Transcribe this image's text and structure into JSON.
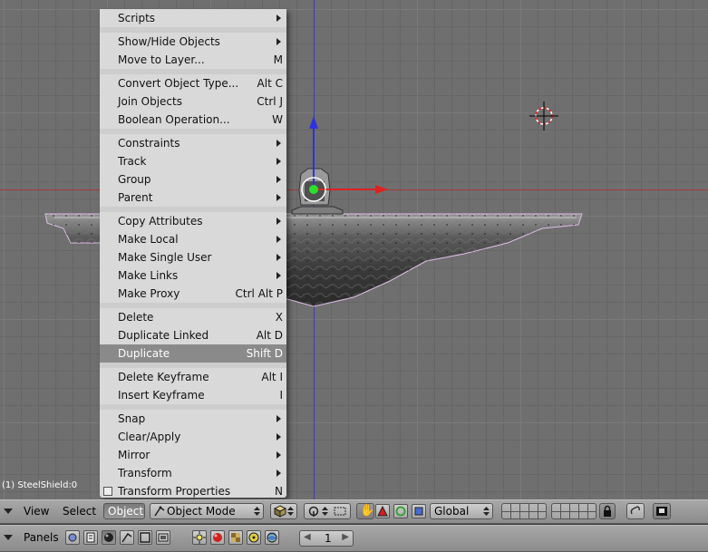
{
  "viewport": {
    "object_label": "(1) SteelShield:0"
  },
  "menu": {
    "items": [
      {
        "label": "Scripts",
        "shortcut": "",
        "submenu": true
      },
      {
        "label": "Show/Hide Objects",
        "shortcut": "",
        "submenu": true
      },
      {
        "label": "Move to Layer...",
        "shortcut": "M",
        "submenu": false
      },
      {
        "label": "Convert Object Type...",
        "shortcut": "Alt C",
        "submenu": false
      },
      {
        "label": "Join Objects",
        "shortcut": "Ctrl J",
        "submenu": false
      },
      {
        "label": "Boolean Operation...",
        "shortcut": "W",
        "submenu": false
      },
      {
        "label": "Constraints",
        "shortcut": "",
        "submenu": true
      },
      {
        "label": "Track",
        "shortcut": "",
        "submenu": true
      },
      {
        "label": "Group",
        "shortcut": "",
        "submenu": true
      },
      {
        "label": "Parent",
        "shortcut": "",
        "submenu": true
      },
      {
        "label": "Copy Attributes",
        "shortcut": "",
        "submenu": true
      },
      {
        "label": "Make Local",
        "shortcut": "",
        "submenu": true
      },
      {
        "label": "Make Single User",
        "shortcut": "",
        "submenu": true
      },
      {
        "label": "Make Links",
        "shortcut": "",
        "submenu": true
      },
      {
        "label": "Make Proxy",
        "shortcut": "Ctrl Alt P",
        "submenu": false
      },
      {
        "label": "Delete",
        "shortcut": "X",
        "submenu": false
      },
      {
        "label": "Duplicate Linked",
        "shortcut": "Alt D",
        "submenu": false
      },
      {
        "label": "Duplicate",
        "shortcut": "Shift D",
        "submenu": false,
        "active": true
      },
      {
        "label": "Delete Keyframe",
        "shortcut": "Alt I",
        "submenu": false
      },
      {
        "label": "Insert Keyframe",
        "shortcut": "I",
        "submenu": false
      },
      {
        "label": "Snap",
        "shortcut": "",
        "submenu": true
      },
      {
        "label": "Clear/Apply",
        "shortcut": "",
        "submenu": true
      },
      {
        "label": "Mirror",
        "shortcut": "",
        "submenu": true
      },
      {
        "label": "Transform",
        "shortcut": "",
        "submenu": true
      },
      {
        "label": "Transform Properties",
        "shortcut": "N",
        "submenu": false,
        "checkbox": true
      }
    ]
  },
  "header": {
    "view_label": "View",
    "select_label": "Select",
    "object_label": "Object",
    "mode_label": "Object Mode",
    "orientation_label": "Global"
  },
  "buttons_bar": {
    "panels_label": "Panels",
    "frame_value": "1"
  },
  "colors": {
    "viewport_bg": "#6f6f6f",
    "menu_bg": "#d9d9d9",
    "menu_active": "#8a8a8a",
    "x_axis": "#a53a3a",
    "y_axis": "#3c3cb0"
  }
}
